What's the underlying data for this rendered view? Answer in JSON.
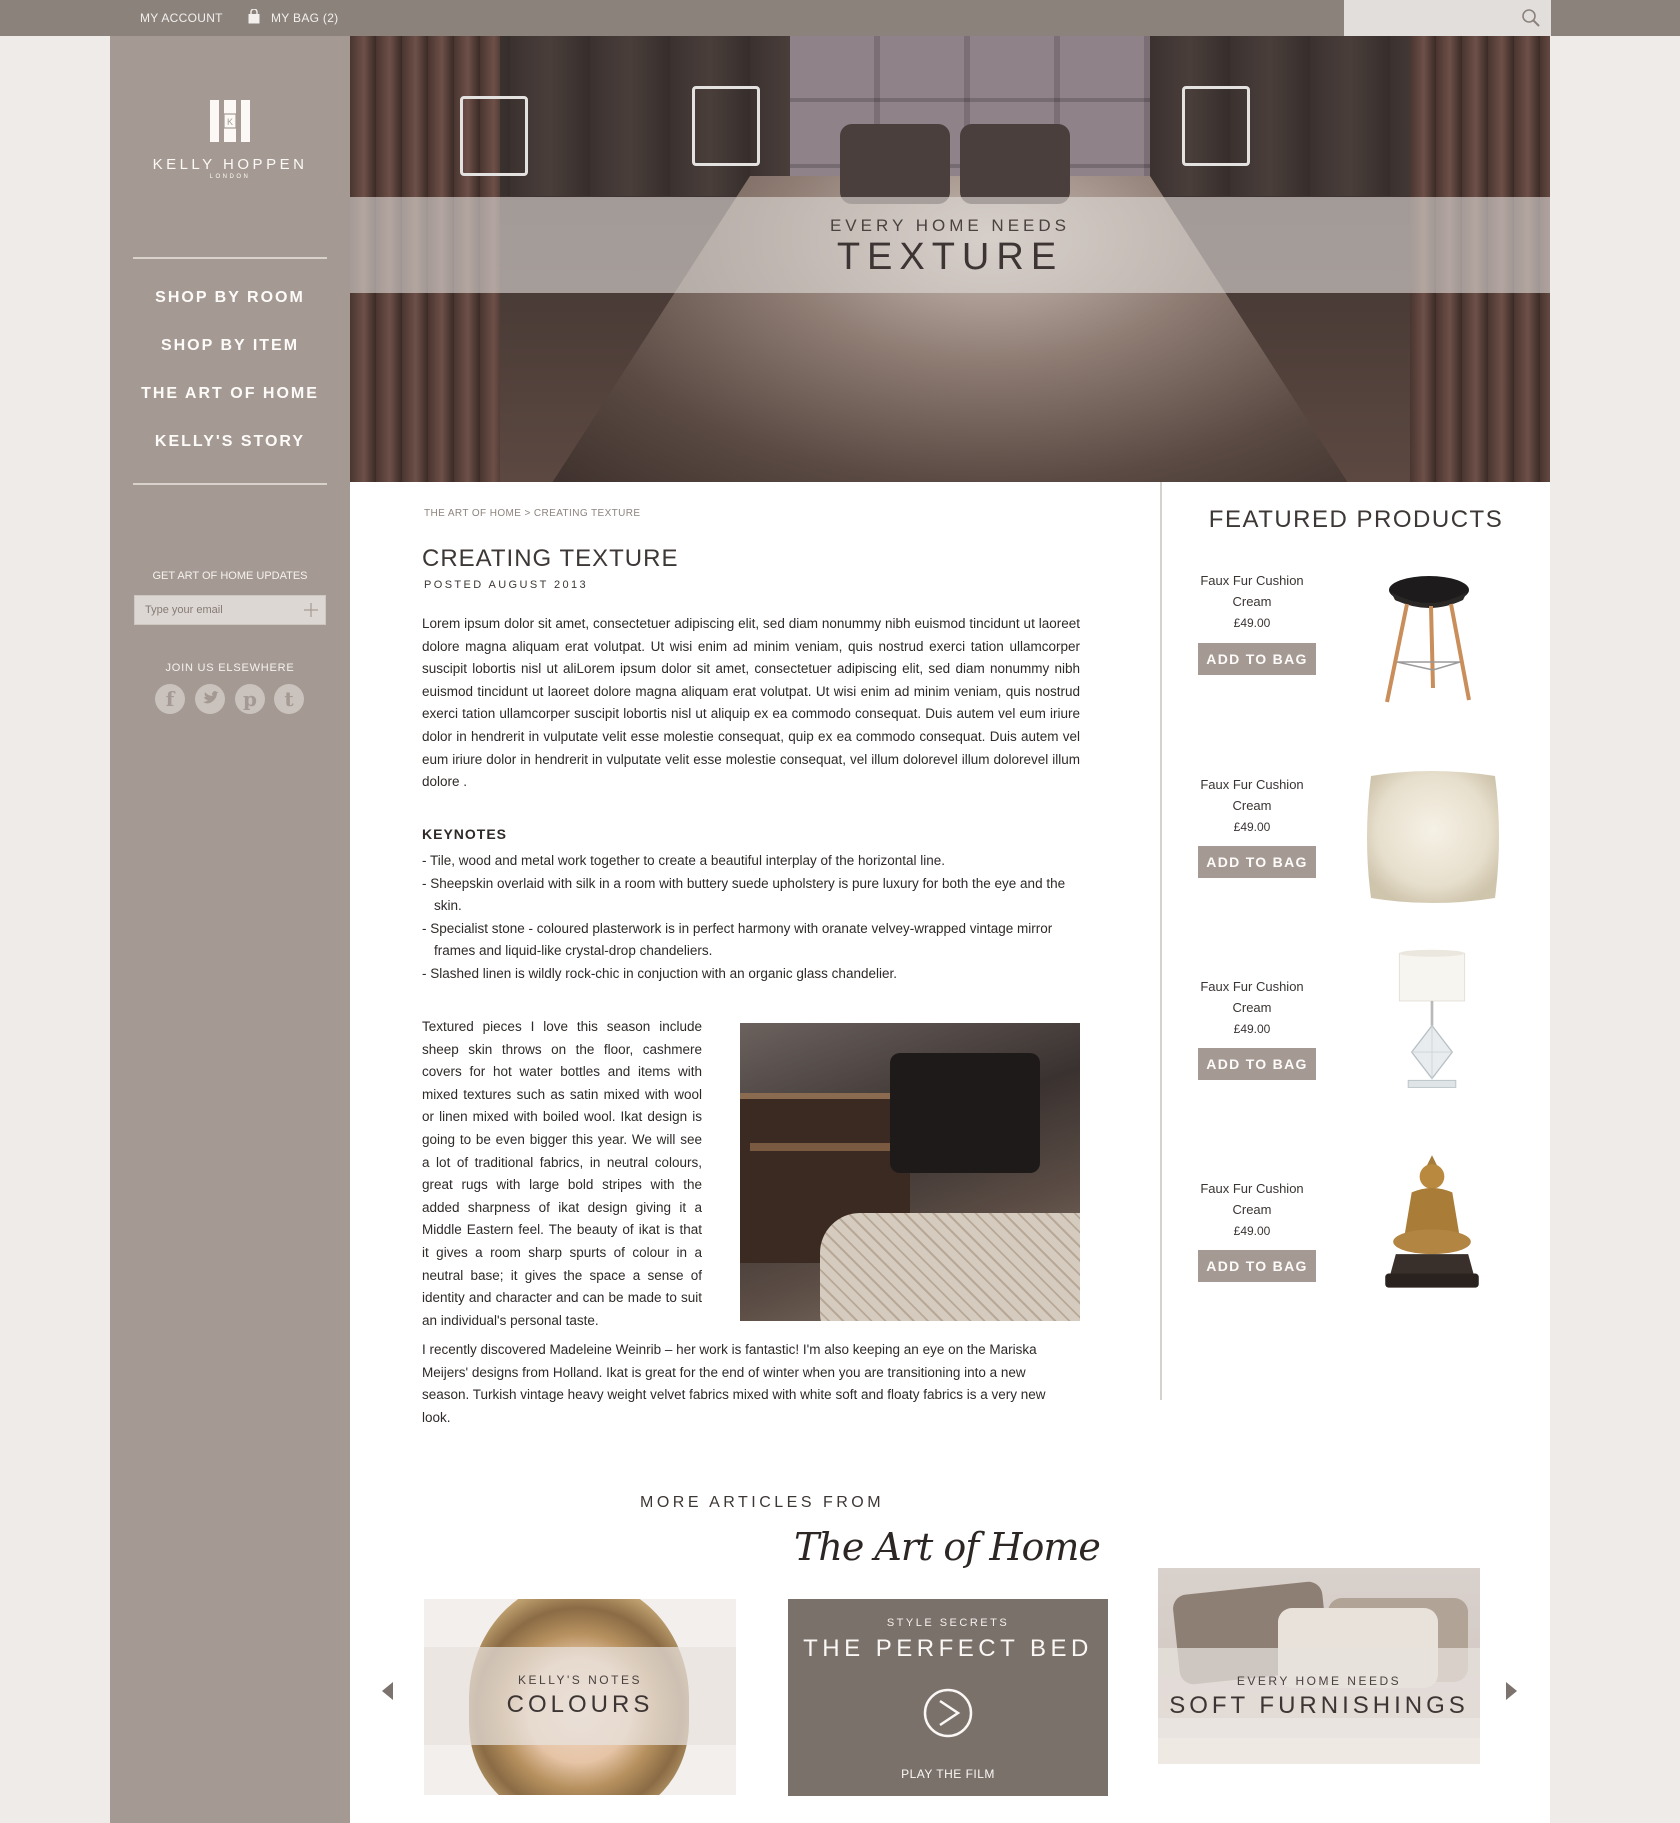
{
  "topbar": {
    "account": "MY ACCOUNT",
    "bag": "MY BAG (2)"
  },
  "brand": {
    "name": "KELLY HOPPEN",
    "location": "LONDON"
  },
  "nav": [
    "SHOP BY ROOM",
    "SHOP BY ITEM",
    "THE ART OF HOME",
    "KELLY'S STORY"
  ],
  "newsletter": {
    "label": "GET ART OF HOME UPDATES",
    "placeholder": "Type your email"
  },
  "social": {
    "label": "JOIN US ELSEWHERE",
    "icons": [
      "facebook-icon",
      "twitter-icon",
      "pinterest-icon",
      "tumblr-icon"
    ]
  },
  "hero": {
    "kicker": "EVERY HOME NEEDS",
    "title": "TEXTURE"
  },
  "article": {
    "breadcrumb": "THE ART OF HOME > CREATING TEXTURE",
    "title": "CREATING TEXTURE",
    "posted": "POSTED AUGUST 2013",
    "intro": "Lorem ipsum dolor sit amet, consectetuer adipiscing elit, sed diam nonummy nibh euismod tincidunt ut laoreet dolore magna aliquam erat volutpat. Ut wisi enim ad minim veniam, quis nostrud exerci tation ullamcorper suscipit lobortis nisl ut aliLorem ipsum dolor sit amet, consectetuer adipiscing elit, sed diam nonummy nibh euismod tincidunt ut laoreet dolore magna aliquam erat volutpat. Ut wisi enim ad minim veniam, quis nostrud exerci tation ullamcorper suscipit lobortis nisl ut aliquip ex ea commodo consequat. Duis autem vel eum iriure dolor in hendrerit in vulputate velit esse molestie consequat, quip ex ea commodo consequat. Duis autem vel eum iriure dolor in hendrerit in vulputate velit esse molestie consequat, vel illum dolorevel illum dolorevel illum dolore .",
    "keynotes_title": "KEYNOTES",
    "keynotes": [
      "- Tile, wood and metal work together to create a beautiful interplay of the horizontal line.",
      "- Sheepskin overlaid with silk in a room with buttery suede upholstery is pure luxury for both the eye and the skin.",
      "- Specialist stone - coloured plasterwork is in perfect harmony with oranate velvey-wrapped vintage mirror frames and liquid-like crystal-drop chandeliers.",
      "- Slashed linen is wildly rock-chic in conjuction with an organic glass chandelier."
    ],
    "column_text": "Textured pieces I love this season include sheep skin throws on the floor, cashmere covers for hot water bottles and items with mixed textures such as satin mixed with wool or linen mixed with boiled wool. Ikat design is going to be even bigger this year. We will see a lot of traditional fabrics, in neutral colours, great rugs with large bold stripes with the added sharpness of ikat design giving it a Middle Eastern feel. The beauty of ikat is that it gives a room sharp spurts of colour in a neutral base; it gives the space a sense of identity and character and can be made to suit an individual's personal taste.",
    "closing_text": "I recently discovered Madeleine Weinrib – her work is fantastic! I'm also keeping an eye on the Mariska Meijers' designs from Holland.  Ikat is great for the end of winter when you are transitioning into a new season. Turkish vintage heavy weight velvet fabrics mixed with white soft and floaty fabrics is a very new look."
  },
  "featured": {
    "title": "FEATURED PRODUCTS",
    "button_label": "ADD TO BAG",
    "products": [
      {
        "name": "Faux Fur Cushion Cream",
        "price": "£49.00",
        "image": "stool"
      },
      {
        "name": "Faux Fur Cushion Cream",
        "price": "£49.00",
        "image": "cushion"
      },
      {
        "name": "Faux Fur Cushion Cream",
        "price": "£49.00",
        "image": "lamp"
      },
      {
        "name": "Faux Fur Cushion Cream",
        "price": "£49.00",
        "image": "buddha"
      }
    ]
  },
  "more_articles": {
    "label": "MORE ARTICLES FROM",
    "script_title": "The Art of Home",
    "cards": [
      {
        "kicker": "KELLY'S NOTES",
        "title": "COLOURS"
      },
      {
        "kicker": "STYLE SECRETS",
        "title": "THE PERFECT BED",
        "action": "PLAY THE FILM"
      },
      {
        "kicker": "EVERY HOME NEEDS",
        "title": "SOFT FURNISHINGS"
      }
    ]
  },
  "colors": {
    "taupe": "#a59a93",
    "topbar": "#8b827c",
    "background": "#eeebe8"
  }
}
